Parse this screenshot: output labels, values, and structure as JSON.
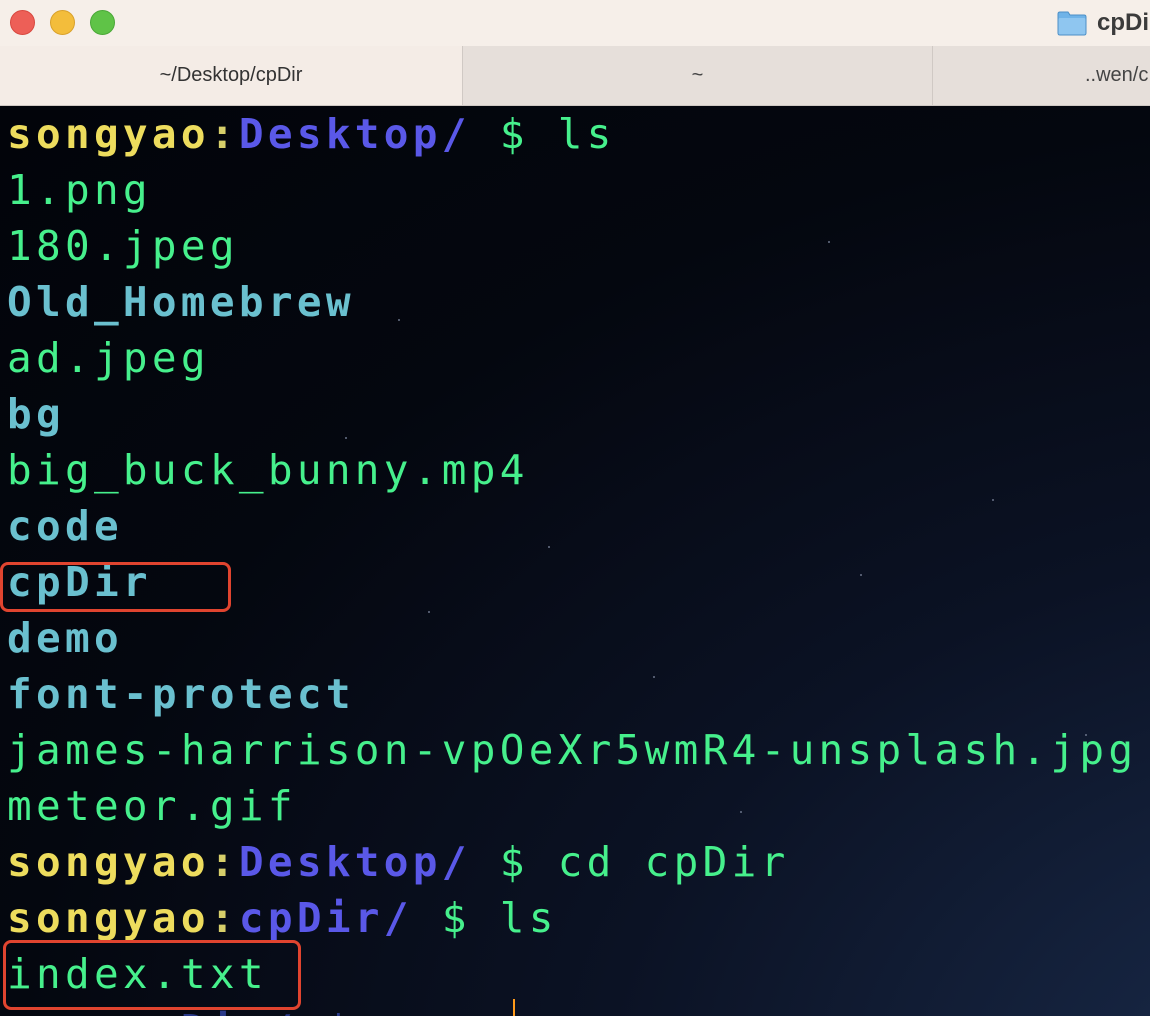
{
  "window": {
    "title": "cpDir",
    "folder_icon": "folder-icon"
  },
  "tabs": [
    {
      "label": "~/Desktop/cpDir",
      "active": true
    },
    {
      "label": "~",
      "active": false
    },
    {
      "label": "..wen/c",
      "active": false
    }
  ],
  "terminal": {
    "prompts": [
      {
        "user": "songyao",
        "sep": ":",
        "path": "Desktop/",
        "symbol": " $ ",
        "command": "ls"
      },
      {
        "user": "songyao",
        "sep": ":",
        "path": "Desktop/",
        "symbol": " $ ",
        "command": "cd cpDir"
      },
      {
        "user": "songyao",
        "sep": ":",
        "path": "cpDir/",
        "symbol": " $ ",
        "command": "ls"
      }
    ],
    "desktop_listing": [
      {
        "name": "1.png",
        "kind": "file"
      },
      {
        "name": "180.jpeg",
        "kind": "file"
      },
      {
        "name": "Old_Homebrew",
        "kind": "dir"
      },
      {
        "name": "ad.jpeg",
        "kind": "file"
      },
      {
        "name": "bg",
        "kind": "dir"
      },
      {
        "name": "big_buck_bunny.mp4",
        "kind": "file"
      },
      {
        "name": "code",
        "kind": "dir"
      },
      {
        "name": "cpDir",
        "kind": "dir"
      },
      {
        "name": "demo",
        "kind": "dir"
      },
      {
        "name": "font-protect",
        "kind": "dir"
      },
      {
        "name": "james-harrison-vpOeXr5wmR4-unsplash.jpg",
        "kind": "file"
      },
      {
        "name": "meteor.gif",
        "kind": "file"
      }
    ],
    "cpdir_listing": [
      {
        "name": "index.txt",
        "kind": "file"
      }
    ],
    "partial_last_line": "     pDir/ $"
  },
  "colors": {
    "user": "#eddc5d",
    "path": "#5a58e8",
    "file": "#46f08c",
    "dir": "#6ac0cf",
    "highlight": "#e0442f",
    "cursor": "#ff9a1a"
  }
}
